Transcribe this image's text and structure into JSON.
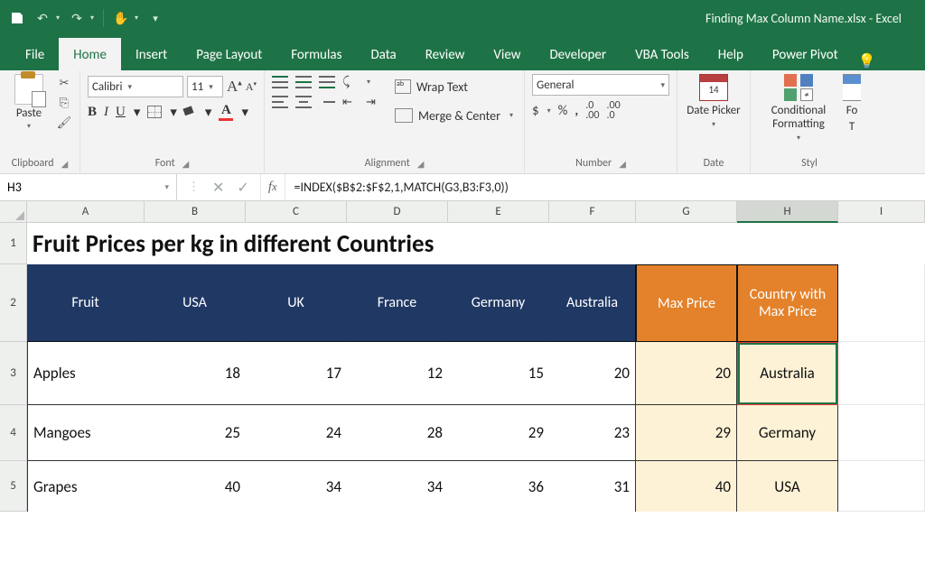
{
  "title": "Finding Max Column Name.xlsx - Excel",
  "tabs": [
    "File",
    "Home",
    "Insert",
    "Page Layout",
    "Formulas",
    "Data",
    "Review",
    "View",
    "Developer",
    "VBA Tools",
    "Help",
    "Power Pivot"
  ],
  "activeTab": "Home",
  "ribbon": {
    "clipboard": {
      "paste": "Paste",
      "label": "Clipboard"
    },
    "font": {
      "name": "Calibri",
      "size": "11",
      "label": "Font"
    },
    "alignment": {
      "wrap": "Wrap Text",
      "merge": "Merge & Center",
      "label": "Alignment"
    },
    "number": {
      "format": "General",
      "label": "Number"
    },
    "date": {
      "btn": "Date Picker",
      "label": "Date"
    },
    "styles": {
      "cond": "Conditional Formatting",
      "fmt": "Fo",
      "tbl": "T",
      "label": "Styl"
    }
  },
  "nameBox": "H3",
  "formula": "=INDEX($B$2:$F$2,1,MATCH(G3,B3:F3,0))",
  "columns": [
    "A",
    "B",
    "C",
    "D",
    "E",
    "F",
    "G",
    "H",
    "I"
  ],
  "rows": [
    "1",
    "2",
    "3",
    "4",
    "5"
  ],
  "sheet": {
    "title": "Fruit Prices per kg in different Countries",
    "headers": [
      "Fruit",
      "USA",
      "UK",
      "France",
      "Germany",
      "Australia",
      "Max Price",
      "Country with Max Price"
    ],
    "data": [
      {
        "fruit": "Apples",
        "vals": [
          "18",
          "17",
          "12",
          "15",
          "20"
        ],
        "max": "20",
        "country": "Australia"
      },
      {
        "fruit": "Mangoes",
        "vals": [
          "25",
          "24",
          "28",
          "29",
          "23"
        ],
        "max": "29",
        "country": "Germany"
      },
      {
        "fruit": "Grapes",
        "vals": [
          "40",
          "34",
          "34",
          "36",
          "31"
        ],
        "max": "40",
        "country": "USA"
      }
    ]
  },
  "chart_data": {
    "type": "table",
    "title": "Fruit Prices per kg in different Countries",
    "columns": [
      "Fruit",
      "USA",
      "UK",
      "France",
      "Germany",
      "Australia",
      "Max Price",
      "Country with Max Price"
    ],
    "rows": [
      [
        "Apples",
        18,
        17,
        12,
        15,
        20,
        20,
        "Australia"
      ],
      [
        "Mangoes",
        25,
        24,
        28,
        29,
        23,
        29,
        "Germany"
      ],
      [
        "Grapes",
        40,
        34,
        34,
        36,
        31,
        40,
        "USA"
      ]
    ]
  }
}
